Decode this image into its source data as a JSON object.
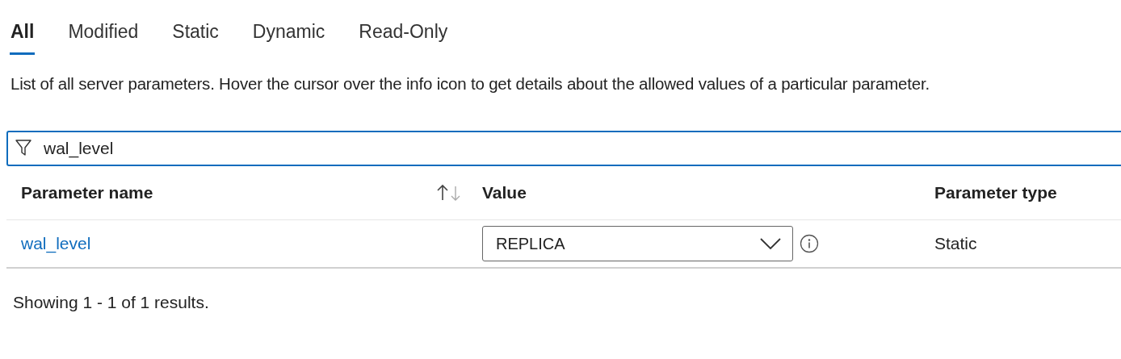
{
  "tabs": [
    {
      "label": "All",
      "selected": true
    },
    {
      "label": "Modified",
      "selected": false
    },
    {
      "label": "Static",
      "selected": false
    },
    {
      "label": "Dynamic",
      "selected": false
    },
    {
      "label": "Read-Only",
      "selected": false
    }
  ],
  "description": "List of all server parameters. Hover the cursor over the info icon to get details about the allowed values of a particular parameter.",
  "filter": {
    "value": "wal_level"
  },
  "table": {
    "columns": [
      "Parameter name",
      "Value",
      "Parameter type"
    ],
    "rows": [
      {
        "name": "wal_level",
        "value": "REPLICA",
        "type": "Static"
      }
    ]
  },
  "footer": "Showing 1 - 1 of 1 results."
}
